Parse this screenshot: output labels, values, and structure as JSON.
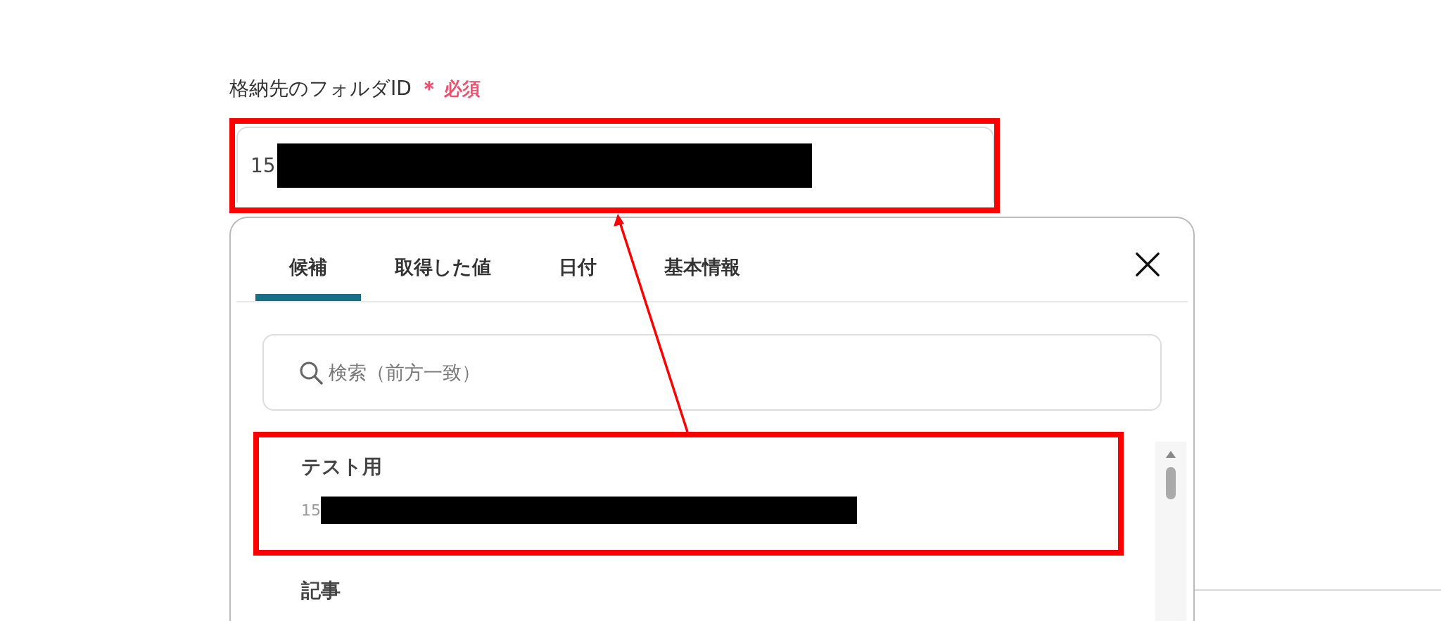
{
  "field": {
    "label": "格納先のフォルダID",
    "required_mark": "＊",
    "required_label": "必須",
    "value": "15",
    "redacted": true,
    "highlighted": true
  },
  "panel": {
    "tabs": [
      {
        "label": "候補",
        "selected": true
      },
      {
        "label": "取得した値",
        "selected": false
      },
      {
        "label": "日付",
        "selected": false
      },
      {
        "label": "基本情報",
        "selected": false
      }
    ],
    "search": {
      "placeholder": "検索（前方一致）"
    },
    "items": [
      {
        "title": "テスト用",
        "value": "15",
        "redacted": true,
        "highlighted": true
      },
      {
        "title": "記事",
        "highlighted": false
      }
    ]
  }
}
